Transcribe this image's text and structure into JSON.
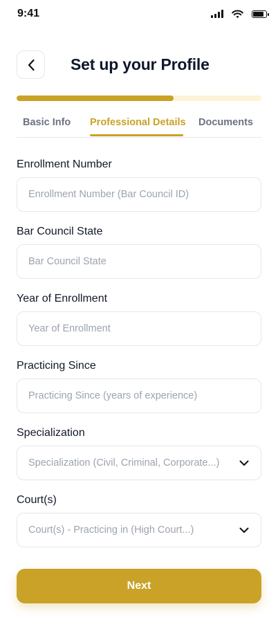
{
  "status_bar": {
    "time": "9:41",
    "battery_level": 0.85
  },
  "header": {
    "title": "Set up your Profile",
    "back_icon": "chevron-left-icon"
  },
  "progress": {
    "value": 0.64,
    "color": "#c9a227",
    "track_color": "#fdf3d7"
  },
  "tabs": [
    {
      "label": "Basic Info",
      "active": false
    },
    {
      "label": "Professional Details",
      "active": true
    },
    {
      "label": "Documents",
      "active": false
    }
  ],
  "form": {
    "enrollment_number": {
      "label": "Enrollment Number",
      "placeholder": "Enrollment Number (Bar Council ID)",
      "value": ""
    },
    "bar_council_state": {
      "label": "Bar Council State",
      "placeholder": "Bar Council State",
      "value": ""
    },
    "year_of_enrollment": {
      "label": "Year of Enrollment",
      "placeholder": "Year of Enrollment",
      "value": ""
    },
    "practicing_since": {
      "label": "Practicing Since",
      "placeholder": "Practicing Since (years of experience)",
      "value": ""
    },
    "specialization": {
      "label": "Specialization",
      "placeholder": "Specialization (Civil, Criminal, Corporate...)",
      "icon": "chevron-down-icon"
    },
    "courts": {
      "label": "Court(s)",
      "placeholder": "Court(s) - Practicing in (High Court...)",
      "icon": "chevron-down-icon"
    }
  },
  "actions": {
    "next_label": "Next"
  },
  "colors": {
    "accent": "#c9a227",
    "title": "#0f172a",
    "muted": "#6b7280",
    "placeholder": "#9ca3af",
    "border": "#e5e7eb"
  }
}
